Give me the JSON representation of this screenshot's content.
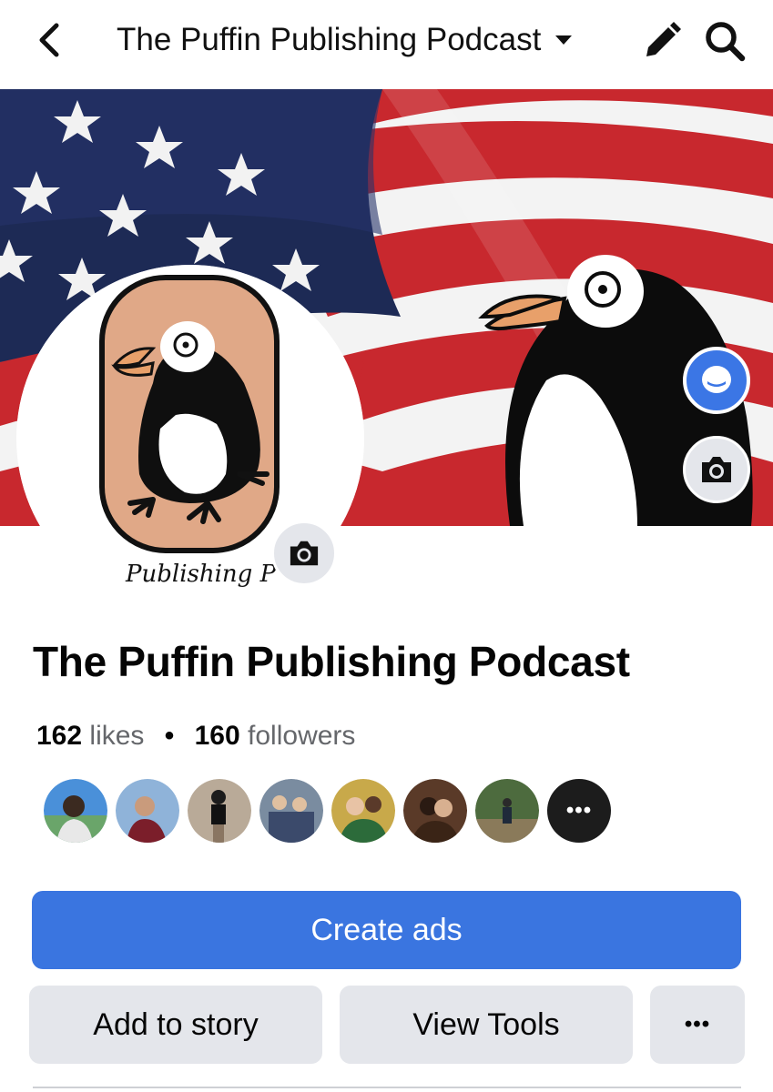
{
  "topbar": {
    "title": "The Puffin Publishing Podcast",
    "back_icon": "chevron-left-icon",
    "dropdown_icon": "caret-down-icon",
    "edit_icon": "pencil-icon",
    "search_icon": "search-icon"
  },
  "cover": {
    "description_icons": [
      "american-flag",
      "puffin-mascot"
    ],
    "messenger_icon": "messenger-icon",
    "camera_icon": "camera-icon"
  },
  "profile": {
    "logo_text": "Publishing P",
    "camera_icon": "camera-icon"
  },
  "page": {
    "name": "The Puffin Publishing Podcast",
    "likes_count": "162",
    "likes_label": "likes",
    "separator": "•",
    "followers_count": "160",
    "followers_label": "followers"
  },
  "friends": {
    "count_shown": 7,
    "more_label": "•••"
  },
  "actions": {
    "create_ads": "Create ads",
    "add_to_story": "Add to story",
    "view_tools": "View Tools",
    "more": "•••"
  },
  "colors": {
    "primary_button": "#3a75e0",
    "secondary_button": "#e4e6eb",
    "messenger_blue": "#3b76e5",
    "muted_text": "#65676b",
    "puffin_skin": "#e0a887"
  }
}
